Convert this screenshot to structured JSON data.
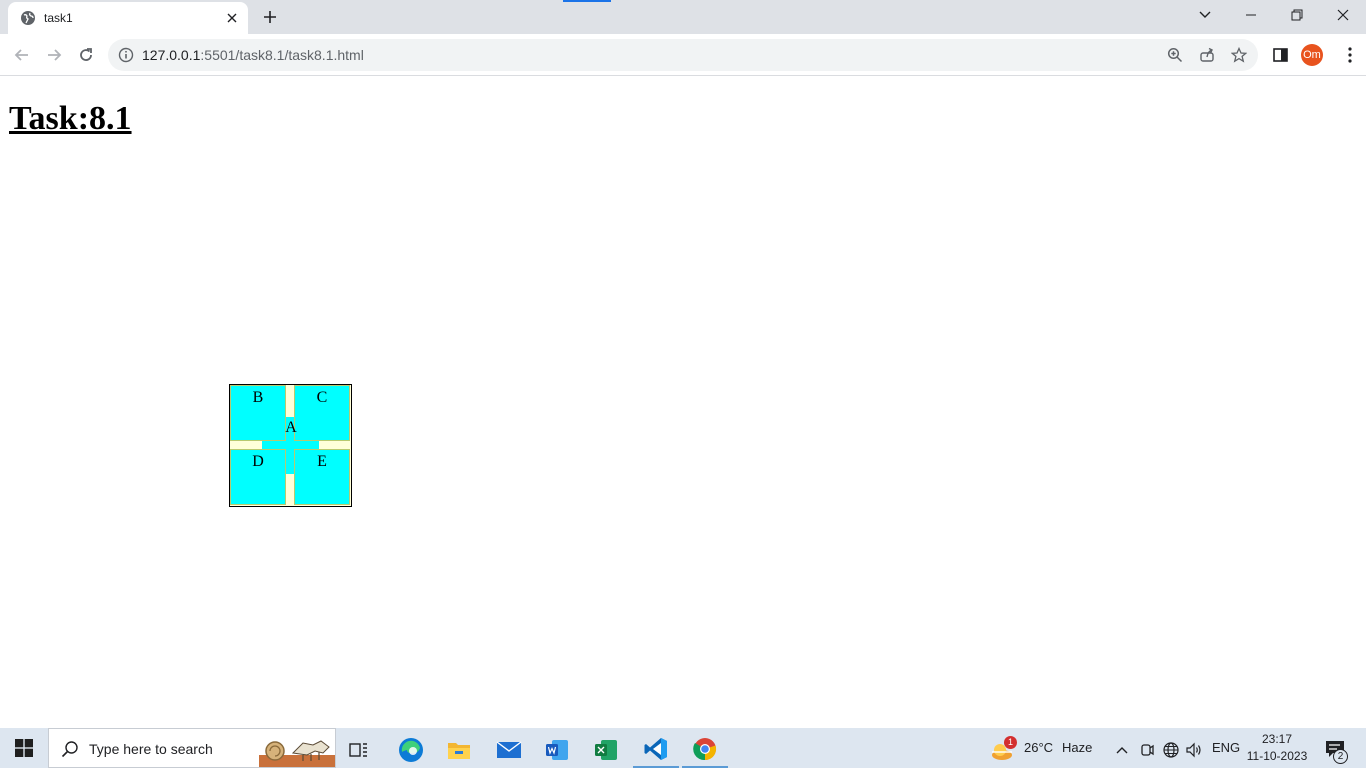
{
  "browser": {
    "tab": {
      "title": "task1"
    },
    "address": {
      "host": "127.0.0.1",
      "rest": ":5501/task8.1/task8.1.html"
    },
    "profile_initials": "Om"
  },
  "page": {
    "heading": "Task:8.1",
    "boxes": {
      "a": "A",
      "b": "B",
      "c": "C",
      "d": "D",
      "e": "E"
    }
  },
  "taskbar": {
    "search_placeholder": "Type here to search",
    "weather": {
      "temp": "26°C",
      "condition": "Haze",
      "badge": "1"
    },
    "language": "ENG",
    "time": "23:17",
    "date": "11-10-2023",
    "notifications": "2"
  },
  "colors": {
    "box_fill": "#00ffff",
    "gap_fill": "#ffffd9",
    "accent": "#1a73e8"
  }
}
